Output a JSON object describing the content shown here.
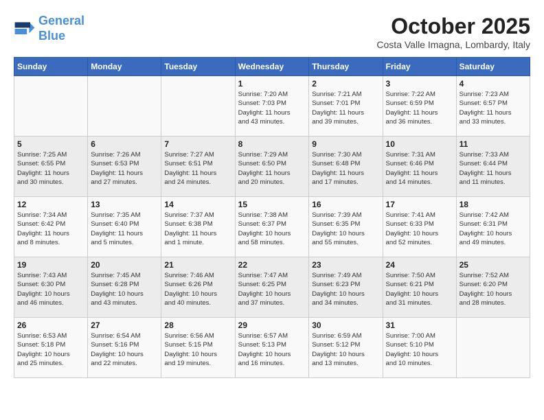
{
  "header": {
    "logo_line1": "General",
    "logo_line2": "Blue",
    "title": "October 2025",
    "subtitle": "Costa Valle Imagna, Lombardy, Italy"
  },
  "weekdays": [
    "Sunday",
    "Monday",
    "Tuesday",
    "Wednesday",
    "Thursday",
    "Friday",
    "Saturday"
  ],
  "weeks": [
    [
      {
        "day": "",
        "info": ""
      },
      {
        "day": "",
        "info": ""
      },
      {
        "day": "",
        "info": ""
      },
      {
        "day": "1",
        "info": "Sunrise: 7:20 AM\nSunset: 7:03 PM\nDaylight: 11 hours\nand 43 minutes."
      },
      {
        "day": "2",
        "info": "Sunrise: 7:21 AM\nSunset: 7:01 PM\nDaylight: 11 hours\nand 39 minutes."
      },
      {
        "day": "3",
        "info": "Sunrise: 7:22 AM\nSunset: 6:59 PM\nDaylight: 11 hours\nand 36 minutes."
      },
      {
        "day": "4",
        "info": "Sunrise: 7:23 AM\nSunset: 6:57 PM\nDaylight: 11 hours\nand 33 minutes."
      }
    ],
    [
      {
        "day": "5",
        "info": "Sunrise: 7:25 AM\nSunset: 6:55 PM\nDaylight: 11 hours\nand 30 minutes."
      },
      {
        "day": "6",
        "info": "Sunrise: 7:26 AM\nSunset: 6:53 PM\nDaylight: 11 hours\nand 27 minutes."
      },
      {
        "day": "7",
        "info": "Sunrise: 7:27 AM\nSunset: 6:51 PM\nDaylight: 11 hours\nand 24 minutes."
      },
      {
        "day": "8",
        "info": "Sunrise: 7:29 AM\nSunset: 6:50 PM\nDaylight: 11 hours\nand 20 minutes."
      },
      {
        "day": "9",
        "info": "Sunrise: 7:30 AM\nSunset: 6:48 PM\nDaylight: 11 hours\nand 17 minutes."
      },
      {
        "day": "10",
        "info": "Sunrise: 7:31 AM\nSunset: 6:46 PM\nDaylight: 11 hours\nand 14 minutes."
      },
      {
        "day": "11",
        "info": "Sunrise: 7:33 AM\nSunset: 6:44 PM\nDaylight: 11 hours\nand 11 minutes."
      }
    ],
    [
      {
        "day": "12",
        "info": "Sunrise: 7:34 AM\nSunset: 6:42 PM\nDaylight: 11 hours\nand 8 minutes."
      },
      {
        "day": "13",
        "info": "Sunrise: 7:35 AM\nSunset: 6:40 PM\nDaylight: 11 hours\nand 5 minutes."
      },
      {
        "day": "14",
        "info": "Sunrise: 7:37 AM\nSunset: 6:38 PM\nDaylight: 11 hours\nand 1 minute."
      },
      {
        "day": "15",
        "info": "Sunrise: 7:38 AM\nSunset: 6:37 PM\nDaylight: 10 hours\nand 58 minutes."
      },
      {
        "day": "16",
        "info": "Sunrise: 7:39 AM\nSunset: 6:35 PM\nDaylight: 10 hours\nand 55 minutes."
      },
      {
        "day": "17",
        "info": "Sunrise: 7:41 AM\nSunset: 6:33 PM\nDaylight: 10 hours\nand 52 minutes."
      },
      {
        "day": "18",
        "info": "Sunrise: 7:42 AM\nSunset: 6:31 PM\nDaylight: 10 hours\nand 49 minutes."
      }
    ],
    [
      {
        "day": "19",
        "info": "Sunrise: 7:43 AM\nSunset: 6:30 PM\nDaylight: 10 hours\nand 46 minutes."
      },
      {
        "day": "20",
        "info": "Sunrise: 7:45 AM\nSunset: 6:28 PM\nDaylight: 10 hours\nand 43 minutes."
      },
      {
        "day": "21",
        "info": "Sunrise: 7:46 AM\nSunset: 6:26 PM\nDaylight: 10 hours\nand 40 minutes."
      },
      {
        "day": "22",
        "info": "Sunrise: 7:47 AM\nSunset: 6:25 PM\nDaylight: 10 hours\nand 37 minutes."
      },
      {
        "day": "23",
        "info": "Sunrise: 7:49 AM\nSunset: 6:23 PM\nDaylight: 10 hours\nand 34 minutes."
      },
      {
        "day": "24",
        "info": "Sunrise: 7:50 AM\nSunset: 6:21 PM\nDaylight: 10 hours\nand 31 minutes."
      },
      {
        "day": "25",
        "info": "Sunrise: 7:52 AM\nSunset: 6:20 PM\nDaylight: 10 hours\nand 28 minutes."
      }
    ],
    [
      {
        "day": "26",
        "info": "Sunrise: 6:53 AM\nSunset: 5:18 PM\nDaylight: 10 hours\nand 25 minutes."
      },
      {
        "day": "27",
        "info": "Sunrise: 6:54 AM\nSunset: 5:16 PM\nDaylight: 10 hours\nand 22 minutes."
      },
      {
        "day": "28",
        "info": "Sunrise: 6:56 AM\nSunset: 5:15 PM\nDaylight: 10 hours\nand 19 minutes."
      },
      {
        "day": "29",
        "info": "Sunrise: 6:57 AM\nSunset: 5:13 PM\nDaylight: 10 hours\nand 16 minutes."
      },
      {
        "day": "30",
        "info": "Sunrise: 6:59 AM\nSunset: 5:12 PM\nDaylight: 10 hours\nand 13 minutes."
      },
      {
        "day": "31",
        "info": "Sunrise: 7:00 AM\nSunset: 5:10 PM\nDaylight: 10 hours\nand 10 minutes."
      },
      {
        "day": "",
        "info": ""
      }
    ]
  ]
}
